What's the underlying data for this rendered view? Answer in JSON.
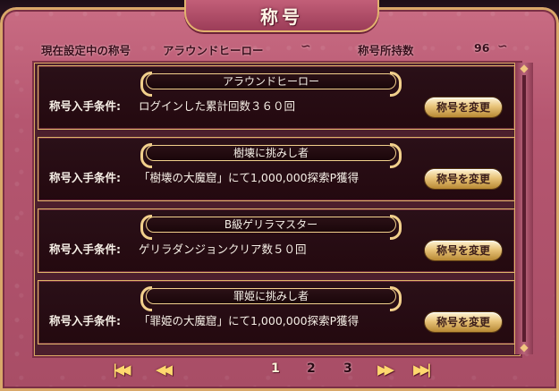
{
  "title": "称号",
  "current": {
    "label": "現在設定中の称号",
    "value": "アラウンドヒーロー",
    "count_label": "称号所持数",
    "count_value": "96"
  },
  "entries": [
    {
      "name": "アラウンドヒーロー",
      "cond_label": "称号入手条件:",
      "cond_text": "ログインした累計回数３６０回",
      "button": "称号を変更"
    },
    {
      "name": "樹壊に挑みし者",
      "cond_label": "称号入手条件:",
      "cond_text": "「樹壊の大魔窟」にて1,000,000探索P獲得",
      "button": "称号を変更"
    },
    {
      "name": "B級ゲリラマスター",
      "cond_label": "称号入手条件:",
      "cond_text": "ゲリラダンジョンクリア数５０回",
      "button": "称号を変更"
    },
    {
      "name": "罪姫に挑みし者",
      "cond_label": "称号入手条件:",
      "cond_text": "「罪姫の大魔窟」にて1,000,000探索P獲得",
      "button": "称号を変更"
    }
  ],
  "pager": {
    "first": "|◀◀",
    "prev": "◀◀",
    "pages": [
      "1",
      "2",
      "3"
    ],
    "current_page": "1",
    "next": "▶▶",
    "last": "▶▶|"
  },
  "colors": {
    "panel": "#b55670",
    "gold": "#e0b56a",
    "entry_bg": "#24090f"
  }
}
